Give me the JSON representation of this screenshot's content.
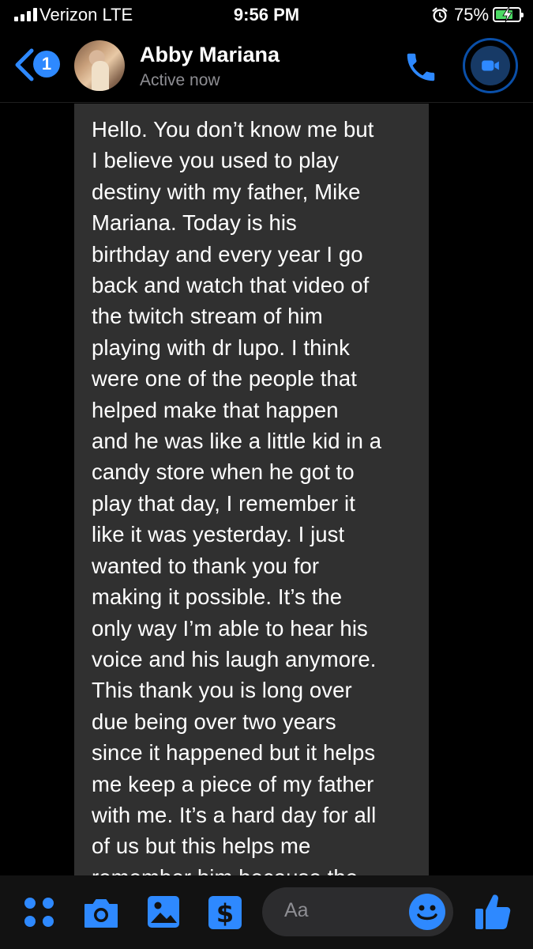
{
  "status_bar": {
    "carrier": "Verizon  LTE",
    "time": "9:56 PM",
    "battery_percent": "75%",
    "battery_level": 0.75,
    "signal_bars": 4,
    "icons": [
      "signal-icon",
      "alarm-icon",
      "battery-charging-icon"
    ]
  },
  "header": {
    "back_badge_count": "1",
    "contact_name": "Abby Mariana",
    "contact_status": "Active now",
    "icons": [
      "back-chevron-icon",
      "phone-icon",
      "video-camera-icon"
    ],
    "accent_color": "#2e89ff"
  },
  "message": {
    "sender": "Abby Mariana",
    "lines": [
      "Hello. You don’t know me but",
      "I believe you used to play",
      "destiny with my father, Mike",
      "Mariana. Today is his",
      "birthday and every year I go",
      "back and watch that video of",
      "the twitch stream of him",
      "playing with dr lupo. I think",
      "were one of the people that",
      "helped make that happen",
      "and he was like a little kid in a",
      "candy store when he got to",
      "play that day, I remember it",
      "like it was yesterday. I just",
      "wanted to thank you for",
      "making it possible. It’s the",
      "only way I’m able to hear his",
      "voice and his laugh anymore.",
      "This thank you is long over",
      "due being over two years",
      "since it happened but it helps",
      "me keep a piece of my father",
      "with me. It’s a hard day for all",
      "of us but this helps me",
      "remember him because the"
    ],
    "bubble_color": "#303030"
  },
  "composer": {
    "placeholder": "Aa",
    "icons": [
      "apps-grid-icon",
      "camera-icon",
      "gallery-icon",
      "payment-icon",
      "emoji-icon",
      "thumbs-up-icon"
    ]
  }
}
